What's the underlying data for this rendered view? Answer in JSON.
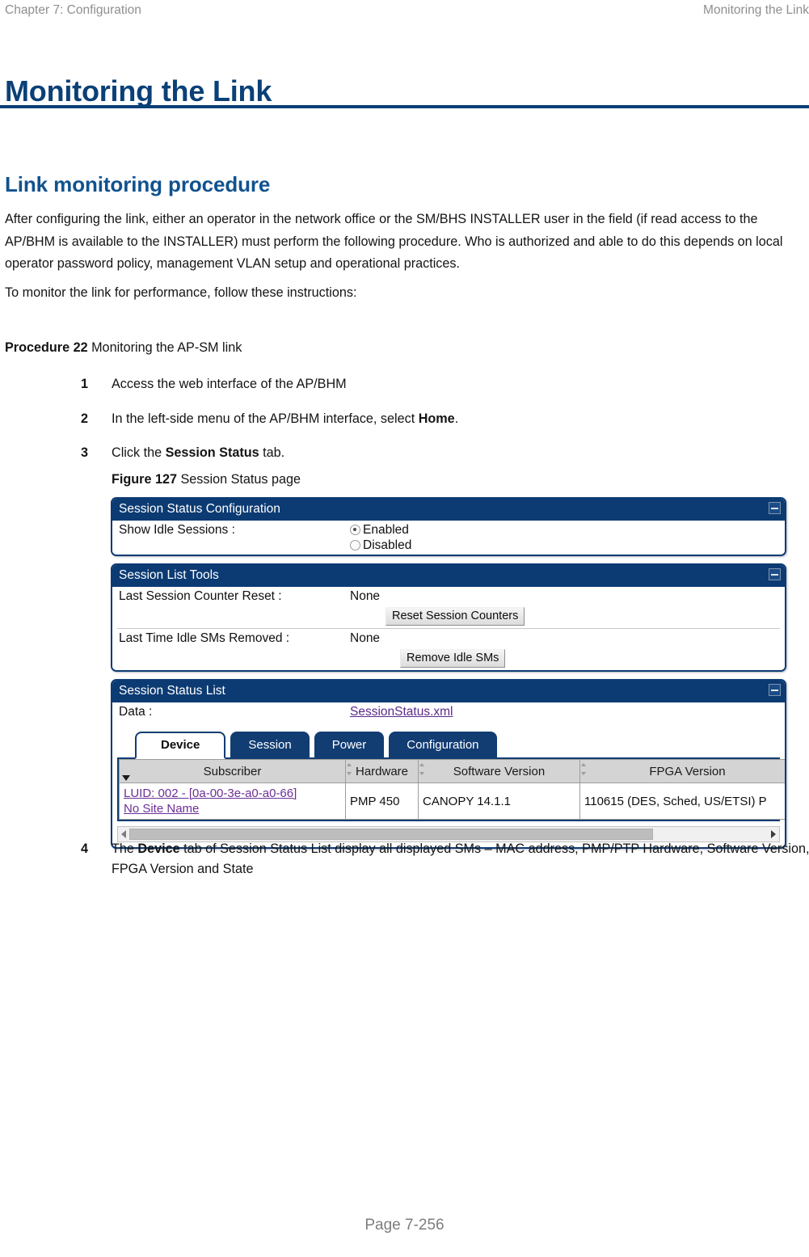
{
  "running_header": {
    "left": "Chapter 7:  Configuration",
    "right": "Monitoring the Link"
  },
  "page_title": "Monitoring the Link",
  "section_heading": "Link monitoring procedure",
  "body": {
    "paragraph_1": "After configuring the link, either an operator in the network office or the SM/BHS INSTALLER user in the field (if read access to the AP/BHM is available to the INSTALLER) must perform the following procedure. Who is authorized and able to do this depends on local operator password policy, management VLAN setup and operational practices.",
    "paragraph_2": "To monitor the link for performance, follow these instructions:"
  },
  "procedure": {
    "label_bold": "Procedure 22",
    "label_rest": " Monitoring the AP-SM link"
  },
  "steps": [
    {
      "num": "1",
      "text_before": "Access the web interface of the AP/BHM",
      "bold": "",
      "text_after": ""
    },
    {
      "num": "2",
      "text_before": "In the left-side menu of the AP/BHM interface, select ",
      "bold": "Home",
      "text_after": "."
    },
    {
      "num": "3",
      "text_before": "Click the ",
      "bold": "Session Status",
      "text_after": " tab."
    },
    {
      "num": "4",
      "text_before": "The ",
      "bold": "Device",
      "text_after": " tab of Session Status List display all displayed SMs – MAC address, PMP/PTP Hardware, Software Version, FPGA Version and State"
    }
  ],
  "figure": {
    "label_bold": "Figure 127",
    "label_rest": " Session Status page"
  },
  "screenshot": {
    "panel_session_status_config": {
      "title": "Session Status Configuration",
      "collapse_icon": "minus-icon",
      "row_label": "Show Idle Sessions :",
      "options": [
        {
          "label": "Enabled",
          "selected": true
        },
        {
          "label": "Disabled",
          "selected": false
        }
      ]
    },
    "panel_session_list_tools": {
      "title": "Session List Tools",
      "collapse_icon": "minus-icon",
      "rows": [
        {
          "label": "Last Session Counter Reset :",
          "value": "None",
          "button": "Reset Session Counters"
        },
        {
          "label": "Last Time Idle SMs Removed :",
          "value": "None",
          "button": "Remove Idle SMs"
        }
      ]
    },
    "panel_session_status_list": {
      "title": "Session Status List",
      "collapse_icon": "minus-icon",
      "data_label": "Data :",
      "data_link": "SessionStatus.xml",
      "tabs": [
        {
          "label": "Device",
          "active": true
        },
        {
          "label": "Session",
          "active": false
        },
        {
          "label": "Power",
          "active": false
        },
        {
          "label": "Configuration",
          "active": false
        }
      ],
      "table": {
        "columns": [
          "Subscriber",
          "Hardware",
          "Software Version",
          "FPGA Version"
        ],
        "sort_column": "Subscriber",
        "sort_icon": "sort-descending-arrow-icon",
        "rows": [
          {
            "subscriber_line1": "LUID: 002 - [0a-00-3e-a0-a0-66]",
            "subscriber_line2": "No Site Name",
            "hardware": "PMP 450",
            "software_version": "CANOPY 14.1.1",
            "fpga_version": "110615 (DES, Sched, US/ETSI) P"
          }
        ]
      },
      "scrollbar": {
        "left_arrow_icon": "arrow-left-icon",
        "right_arrow_icon": "arrow-right-icon"
      }
    }
  },
  "footer": "Page 7-256",
  "colors": {
    "brand_blue": "#0b4077",
    "heading_blue": "#11528f",
    "panel_header": "#0c3b73",
    "link_purple": "#6b2f96"
  }
}
